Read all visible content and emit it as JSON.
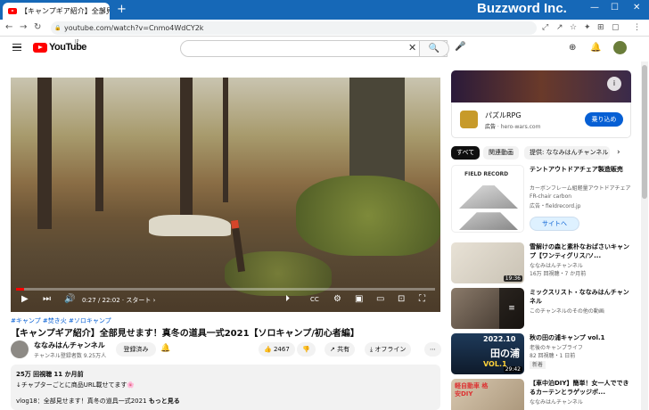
{
  "browser": {
    "tab_title": "【キャンプギア紹介】全部見せます！",
    "new_tab": "+",
    "brand": "Buzzword Inc.",
    "url": "youtube.com/watch?v=Cnmo4WdCY2k",
    "controls": {
      "minimize": "—",
      "maximize": "☐",
      "close": "✕"
    },
    "nav": {
      "back": "←",
      "forward": "→",
      "reload": "↻"
    },
    "ext_icons": [
      "⤢",
      "↗",
      "☆",
      "✦",
      "⊞",
      "▢",
      "⋮"
    ]
  },
  "header": {
    "logo": "YouTube",
    "logo_sup": "JP",
    "search_placeholder": "",
    "clear": "✕",
    "search_icon": "🔍",
    "mic_icon": "🎤",
    "create_icon": "⊕",
    "bell_icon": "🔔"
  },
  "player": {
    "time": "0:27 / 22:02 · スタート ›",
    "progress": 0.02,
    "controls": {
      "play": "▶",
      "next": "⏭",
      "volume": "🔊",
      "autoplay": "⏵",
      "captions": "CC",
      "settings": "⚙",
      "miniplayer": "▣",
      "theater": "▭",
      "cast": "⊡",
      "fullscreen": "⛶"
    }
  },
  "video": {
    "hashtags": "#キャンプ #焚き火 #ソロキャンプ",
    "title": "【キャンプギア紹介】全部見せます！真冬の道具一式2021【ソロキャンプ/初心者編】",
    "channel": "ななみはんチャンネル",
    "subscribers": "チャンネル登録者数 9.25万人",
    "subscribed_label": "登録済み",
    "likes": "2467",
    "dislike": "👎",
    "share": "共有",
    "offline": "オフライン",
    "more": "⋯",
    "views": "25万 回視聴",
    "age": "11 か月前",
    "desc_line1": "↓チャプターごとに商品URL載せてます🌸",
    "desc_line2": "vlog18：全部見せます！真冬の道具一式2021",
    "more_link": "もっと見る"
  },
  "ad": {
    "title": "パズルRPG",
    "label": "広告",
    "domain": "hero-wars.com",
    "button": "乗り込め",
    "info": "i"
  },
  "chips": [
    "すべて",
    "関連動画",
    "提供: ななみはんチャンネル"
  ],
  "recommendations": [
    {
      "title": "テントアウトドアチェア製造販売",
      "line2": "カーボンフレーム組軽量アウトドアチェア FR-chair carbon",
      "line3": "広告・fieldrecord.jp",
      "button": "サイトへ",
      "thumb_brand": "FIELD RECORD"
    },
    {
      "title": "雪解けの森と素朴なおばさいキャンプ【ワンティグリス/ソ...",
      "channel": "ななみはんチャンネル",
      "meta": "16万 回視聴・7 か月前",
      "duration": "19:36"
    },
    {
      "title": "ミックスリスト・ななみはんチャンネル",
      "channel": "このチャンネルのその他の動画",
      "meta": ""
    },
    {
      "title": "秋の田の浦キャンプ vol.1",
      "channel": "老後のキャンプライフ",
      "meta": "82 回視聴・1 日前",
      "badge": "新着",
      "duration": "29:42",
      "thumb_year": "2022.10",
      "thumb_big": "田の浦",
      "thumb_vol": "VOL.1"
    },
    {
      "title": "【車中泊DIY】簡単！女一人でできるカーテンとラゲッジボ...",
      "channel": "ななみはんチャンネル",
      "meta": "",
      "thumb_text": "軽自動車 格安DIY"
    }
  ]
}
